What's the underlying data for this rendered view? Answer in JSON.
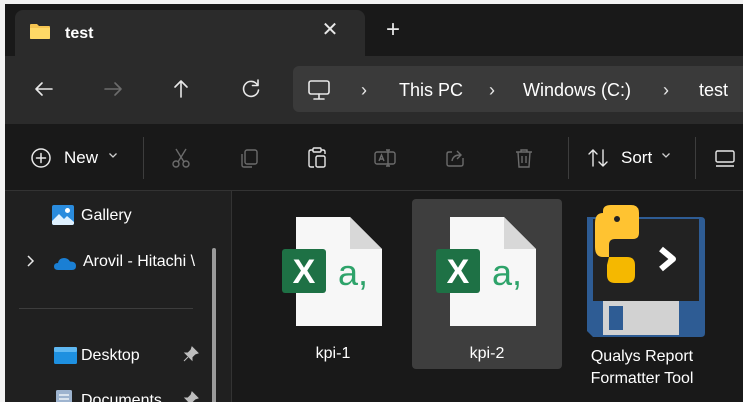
{
  "window": {
    "tab": {
      "title": "test",
      "folder_icon": "folder-icon",
      "close_icon": "close-icon"
    },
    "new_tab_icon": "plus-icon"
  },
  "navigation": {
    "back_icon": "arrow-left-icon",
    "forward_icon": "arrow-right-icon",
    "up_icon": "arrow-up-icon",
    "refresh_icon": "refresh-icon",
    "breadcrumb": [
      "This PC",
      "Windows (C:)",
      "test"
    ]
  },
  "commands": {
    "new_label": "New",
    "sort_label": "Sort",
    "icons": [
      "plus-circle-icon",
      "cut-icon",
      "copy-icon",
      "paste-icon",
      "rename-icon",
      "share-icon",
      "delete-icon",
      "sort-icon",
      "view-icon"
    ]
  },
  "sidebar": {
    "items": [
      {
        "label": "Gallery",
        "icon": "gallery-icon"
      },
      {
        "label": "Arovil - Hitachi \\",
        "icon": "cloud-icon"
      },
      {
        "label": "Desktop",
        "icon": "desktop-folder-icon",
        "pinned": true
      },
      {
        "label": "Documents",
        "icon": "documents-folder-icon",
        "pinned": true
      }
    ]
  },
  "files": [
    {
      "name": "kpi-1",
      "type": "Excel CSV",
      "icon": "excel-csv-icon",
      "selected": false
    },
    {
      "name": "kpi-2",
      "type": "Excel CSV",
      "icon": "excel-csv-icon",
      "selected": true
    },
    {
      "name_line1": "Qualys Report",
      "name_line2": "Formatter Tool",
      "type": "Python script",
      "icon": "python-icon",
      "selected": false
    }
  ],
  "colors": {
    "window_bg": "#191919",
    "toolbar_bg": "#2b2b2b",
    "sidebar_bg": "#202020",
    "selected_bg": "#3e3e3e",
    "excel_green": "#1e7145",
    "onedrive_blue": "#1a7fd4"
  }
}
